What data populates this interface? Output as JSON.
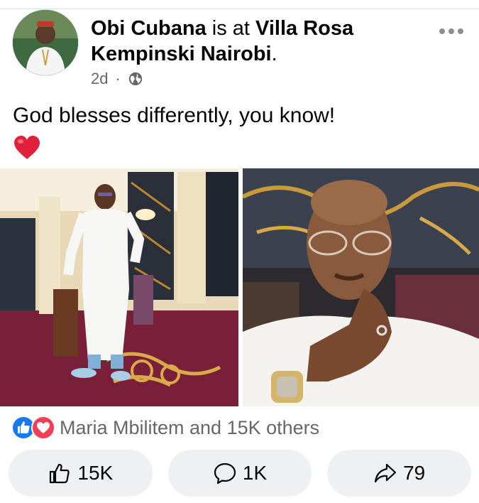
{
  "post": {
    "author": "Obi Cubana",
    "connector": " is at ",
    "place": "Villa Rosa Kempinski Nairobi",
    "punct": ".",
    "time": "2d",
    "separator": "·",
    "privacy_icon": "globe-icon",
    "text": "God blesses differently, you know!",
    "emoji": "red-heart"
  },
  "reactions": {
    "icons": [
      "like-reaction-icon",
      "love-reaction-icon"
    ],
    "summary": "Maria Mbilitem and 15K others"
  },
  "actions": [
    {
      "icon": "like-icon",
      "label": "15K"
    },
    {
      "icon": "comment-icon",
      "label": "1K"
    },
    {
      "icon": "share-icon",
      "label": "79"
    }
  ],
  "colors": {
    "like_blue": "#1877f2",
    "love_red": "#f33e58",
    "meta_gray": "#65676b",
    "button_bg": "#eff0f2"
  }
}
